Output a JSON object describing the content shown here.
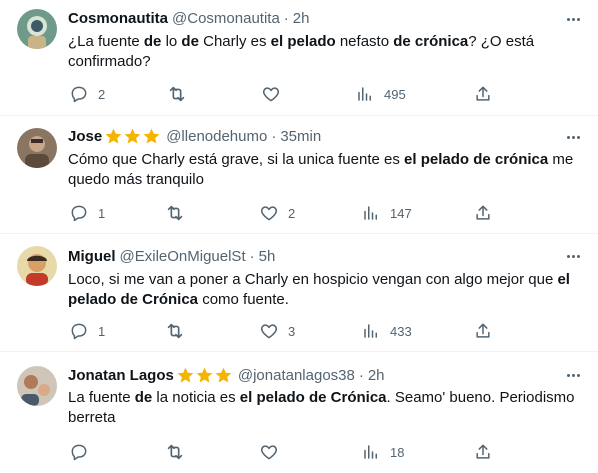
{
  "tweets": [
    {
      "name": "Cosmonautita",
      "stars": 0,
      "handle": "@Cosmonautita",
      "dot": "·",
      "time": "2h",
      "lines": [
        [
          [
            "¿La fuente ",
            false
          ],
          [
            "de",
            true
          ],
          [
            " lo ",
            false
          ],
          [
            "de",
            true
          ],
          [
            " Charly es ",
            false
          ],
          [
            "el pelado",
            true
          ],
          [
            " nefasto ",
            false
          ],
          [
            "de crónica",
            true
          ],
          [
            "? ¿O está",
            false
          ]
        ],
        [
          [
            "confirmado?",
            false
          ]
        ]
      ],
      "replies": "2",
      "retweets": "",
      "likes": "",
      "views": "495"
    },
    {
      "name": "Jose",
      "stars": 3,
      "handle": "@llenodehumo",
      "dot": "·",
      "time": "35min",
      "lines": [
        [
          [
            "Cómo que Charly está grave, si la unica fuente es ",
            false
          ],
          [
            "el pelado de crónica",
            true
          ],
          [
            " me",
            false
          ]
        ],
        [
          [
            "quedo más tranquilo",
            false
          ]
        ]
      ],
      "replies": "1",
      "retweets": "",
      "likes": "2",
      "views": "147"
    },
    {
      "name": "Miguel",
      "stars": 0,
      "handle": "@ExileOnMiguelSt",
      "dot": "·",
      "time": "5h",
      "lines": [
        [
          [
            "Loco, si me van a poner a Charly en hospicio vengan con algo mejor que ",
            false
          ],
          [
            "el",
            true
          ]
        ],
        [
          [
            "pelado de Crónica",
            true
          ],
          [
            " como fuente.",
            false
          ]
        ]
      ],
      "replies": "1",
      "retweets": "",
      "likes": "3",
      "views": "433"
    },
    {
      "name": "Jonatan Lagos",
      "stars": 3,
      "handle": "@jonatanlagos38",
      "dot": "·",
      "time": "2h",
      "lines": [
        [
          [
            "La fuente ",
            false
          ],
          [
            "de",
            true
          ],
          [
            " la noticia es ",
            false
          ],
          [
            "el pelado de Crónica",
            true
          ],
          [
            ". Seamo' bueno. Periodismo",
            false
          ]
        ],
        [
          [
            "berreta",
            false
          ]
        ]
      ],
      "replies": "",
      "retweets": "",
      "likes": "",
      "views": "18"
    }
  ],
  "colors": {
    "text": "#0f1419",
    "secondary": "#536471",
    "star": "#f4b400",
    "divider": "#eff3f4"
  },
  "icons": [
    "reply-icon",
    "retweet-icon",
    "like-icon",
    "views-icon",
    "share-icon",
    "more-icon",
    "star-icon"
  ]
}
